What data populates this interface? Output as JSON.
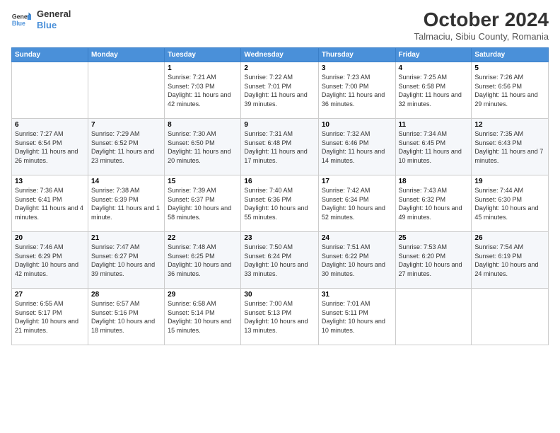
{
  "header": {
    "logo_line1": "General",
    "logo_line2": "Blue",
    "month": "October 2024",
    "location": "Talmaciu, Sibiu County, Romania"
  },
  "weekdays": [
    "Sunday",
    "Monday",
    "Tuesday",
    "Wednesday",
    "Thursday",
    "Friday",
    "Saturday"
  ],
  "weeks": [
    [
      {
        "day": "",
        "info": ""
      },
      {
        "day": "",
        "info": ""
      },
      {
        "day": "1",
        "info": "Sunrise: 7:21 AM\nSunset: 7:03 PM\nDaylight: 11 hours and 42 minutes."
      },
      {
        "day": "2",
        "info": "Sunrise: 7:22 AM\nSunset: 7:01 PM\nDaylight: 11 hours and 39 minutes."
      },
      {
        "day": "3",
        "info": "Sunrise: 7:23 AM\nSunset: 7:00 PM\nDaylight: 11 hours and 36 minutes."
      },
      {
        "day": "4",
        "info": "Sunrise: 7:25 AM\nSunset: 6:58 PM\nDaylight: 11 hours and 32 minutes."
      },
      {
        "day": "5",
        "info": "Sunrise: 7:26 AM\nSunset: 6:56 PM\nDaylight: 11 hours and 29 minutes."
      }
    ],
    [
      {
        "day": "6",
        "info": "Sunrise: 7:27 AM\nSunset: 6:54 PM\nDaylight: 11 hours and 26 minutes."
      },
      {
        "day": "7",
        "info": "Sunrise: 7:29 AM\nSunset: 6:52 PM\nDaylight: 11 hours and 23 minutes."
      },
      {
        "day": "8",
        "info": "Sunrise: 7:30 AM\nSunset: 6:50 PM\nDaylight: 11 hours and 20 minutes."
      },
      {
        "day": "9",
        "info": "Sunrise: 7:31 AM\nSunset: 6:48 PM\nDaylight: 11 hours and 17 minutes."
      },
      {
        "day": "10",
        "info": "Sunrise: 7:32 AM\nSunset: 6:46 PM\nDaylight: 11 hours and 14 minutes."
      },
      {
        "day": "11",
        "info": "Sunrise: 7:34 AM\nSunset: 6:45 PM\nDaylight: 11 hours and 10 minutes."
      },
      {
        "day": "12",
        "info": "Sunrise: 7:35 AM\nSunset: 6:43 PM\nDaylight: 11 hours and 7 minutes."
      }
    ],
    [
      {
        "day": "13",
        "info": "Sunrise: 7:36 AM\nSunset: 6:41 PM\nDaylight: 11 hours and 4 minutes."
      },
      {
        "day": "14",
        "info": "Sunrise: 7:38 AM\nSunset: 6:39 PM\nDaylight: 11 hours and 1 minute."
      },
      {
        "day": "15",
        "info": "Sunrise: 7:39 AM\nSunset: 6:37 PM\nDaylight: 10 hours and 58 minutes."
      },
      {
        "day": "16",
        "info": "Sunrise: 7:40 AM\nSunset: 6:36 PM\nDaylight: 10 hours and 55 minutes."
      },
      {
        "day": "17",
        "info": "Sunrise: 7:42 AM\nSunset: 6:34 PM\nDaylight: 10 hours and 52 minutes."
      },
      {
        "day": "18",
        "info": "Sunrise: 7:43 AM\nSunset: 6:32 PM\nDaylight: 10 hours and 49 minutes."
      },
      {
        "day": "19",
        "info": "Sunrise: 7:44 AM\nSunset: 6:30 PM\nDaylight: 10 hours and 45 minutes."
      }
    ],
    [
      {
        "day": "20",
        "info": "Sunrise: 7:46 AM\nSunset: 6:29 PM\nDaylight: 10 hours and 42 minutes."
      },
      {
        "day": "21",
        "info": "Sunrise: 7:47 AM\nSunset: 6:27 PM\nDaylight: 10 hours and 39 minutes."
      },
      {
        "day": "22",
        "info": "Sunrise: 7:48 AM\nSunset: 6:25 PM\nDaylight: 10 hours and 36 minutes."
      },
      {
        "day": "23",
        "info": "Sunrise: 7:50 AM\nSunset: 6:24 PM\nDaylight: 10 hours and 33 minutes."
      },
      {
        "day": "24",
        "info": "Sunrise: 7:51 AM\nSunset: 6:22 PM\nDaylight: 10 hours and 30 minutes."
      },
      {
        "day": "25",
        "info": "Sunrise: 7:53 AM\nSunset: 6:20 PM\nDaylight: 10 hours and 27 minutes."
      },
      {
        "day": "26",
        "info": "Sunrise: 7:54 AM\nSunset: 6:19 PM\nDaylight: 10 hours and 24 minutes."
      }
    ],
    [
      {
        "day": "27",
        "info": "Sunrise: 6:55 AM\nSunset: 5:17 PM\nDaylight: 10 hours and 21 minutes."
      },
      {
        "day": "28",
        "info": "Sunrise: 6:57 AM\nSunset: 5:16 PM\nDaylight: 10 hours and 18 minutes."
      },
      {
        "day": "29",
        "info": "Sunrise: 6:58 AM\nSunset: 5:14 PM\nDaylight: 10 hours and 15 minutes."
      },
      {
        "day": "30",
        "info": "Sunrise: 7:00 AM\nSunset: 5:13 PM\nDaylight: 10 hours and 13 minutes."
      },
      {
        "day": "31",
        "info": "Sunrise: 7:01 AM\nSunset: 5:11 PM\nDaylight: 10 hours and 10 minutes."
      },
      {
        "day": "",
        "info": ""
      },
      {
        "day": "",
        "info": ""
      }
    ]
  ]
}
